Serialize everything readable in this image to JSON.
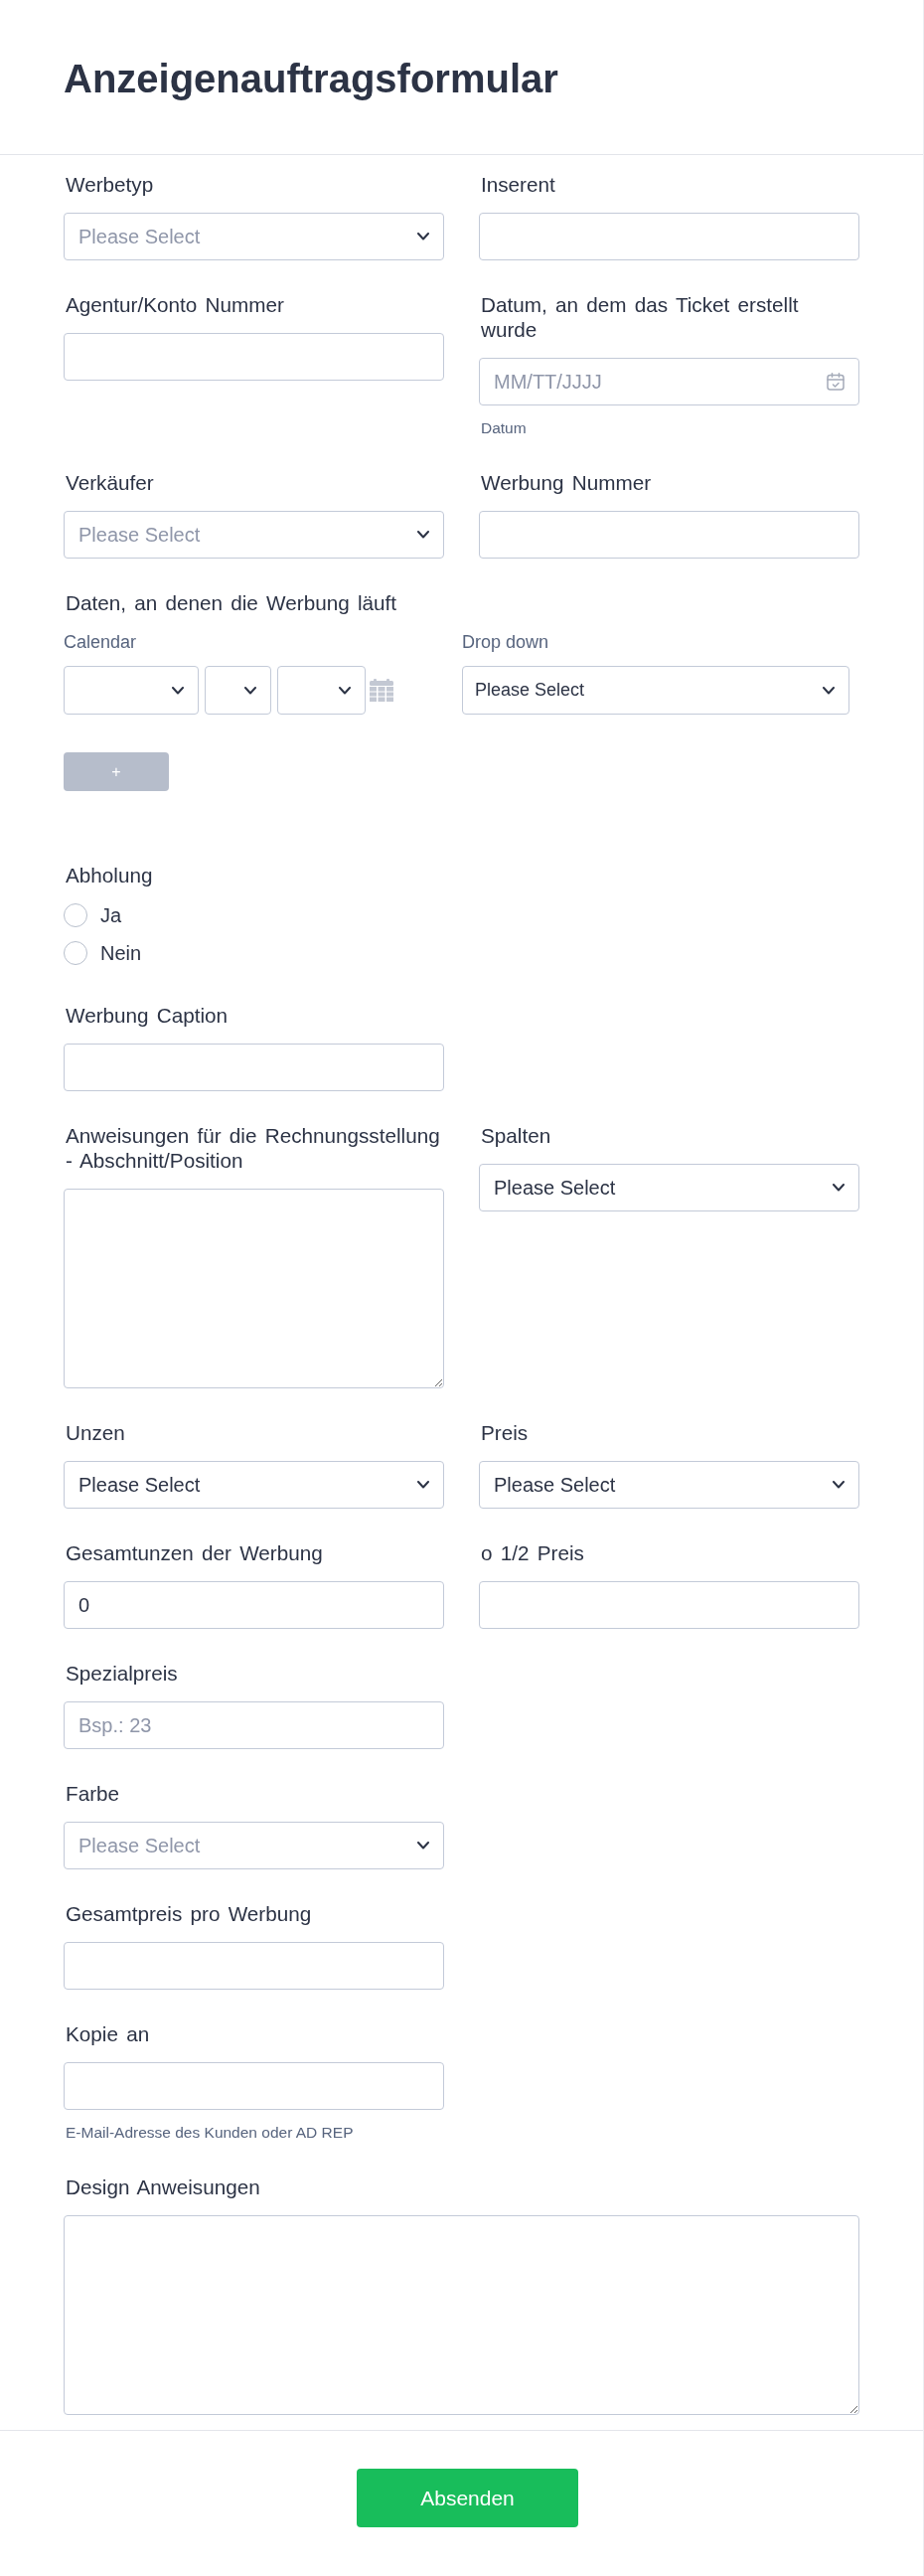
{
  "header": {
    "title": "Anzeigenauftragsformular"
  },
  "rows": [
    [
      {
        "kind": "select",
        "label": "Werbetyp",
        "placeholder": "Please Select"
      },
      {
        "kind": "text",
        "label": "Inserent"
      }
    ],
    [
      {
        "kind": "text",
        "label": "Agentur/Konto Nummer"
      },
      {
        "kind": "date",
        "label": "Datum, an dem das Ticket erstellt wurde",
        "placeholder": "MM/TT/JJJJ",
        "hint": "Datum"
      }
    ],
    [
      {
        "kind": "select",
        "label": "Verkäufer",
        "placeholder": "Please Select"
      },
      {
        "kind": "text",
        "label": "Werbung Nummer"
      }
    ],
    [
      {
        "kind": "date_range",
        "label": "Daten, an denen die Werbung läuft",
        "calendar": {
          "label": "Calendar"
        },
        "dropdown": {
          "label": "Drop down",
          "value": "Please Select"
        },
        "add_button": {
          "label": "+",
          "disabled": true
        }
      }
    ],
    [
      {
        "kind": "radio",
        "label": "Abholung",
        "options": [
          {
            "label": "Ja",
            "selected": false
          },
          {
            "label": "Nein",
            "selected": false
          }
        ]
      }
    ],
    [
      {
        "kind": "text",
        "label": "Werbung Caption"
      }
    ],
    [
      {
        "kind": "textarea",
        "label": "Anweisungen für die Rechnungsstellung - Abschnitt/Position"
      },
      {
        "kind": "select",
        "label": "Spalten",
        "value": "Please Select"
      }
    ],
    [
      {
        "kind": "select",
        "label": "Unzen",
        "value": "Please Select"
      },
      {
        "kind": "select",
        "label": "Preis",
        "value": "Please Select"
      }
    ],
    [
      {
        "kind": "text",
        "label": "Gesamtunzen der Werbung",
        "value": "0"
      },
      {
        "kind": "text",
        "label": "o 1/2 Preis"
      }
    ],
    [
      {
        "kind": "text",
        "label": "Spezialpreis",
        "placeholder": "Bsp.: 23"
      }
    ],
    [
      {
        "kind": "select",
        "label": "Farbe",
        "placeholder": "Please Select"
      }
    ],
    [
      {
        "kind": "text",
        "label": "Gesamtpreis pro Werbung"
      }
    ],
    [
      {
        "kind": "text",
        "label": "Kopie an",
        "hint": "E-Mail-Adresse des Kunden oder AD REP"
      }
    ],
    [
      {
        "kind": "textarea",
        "label": "Design Anweisungen"
      }
    ]
  ],
  "submit": {
    "label": "Absenden"
  }
}
